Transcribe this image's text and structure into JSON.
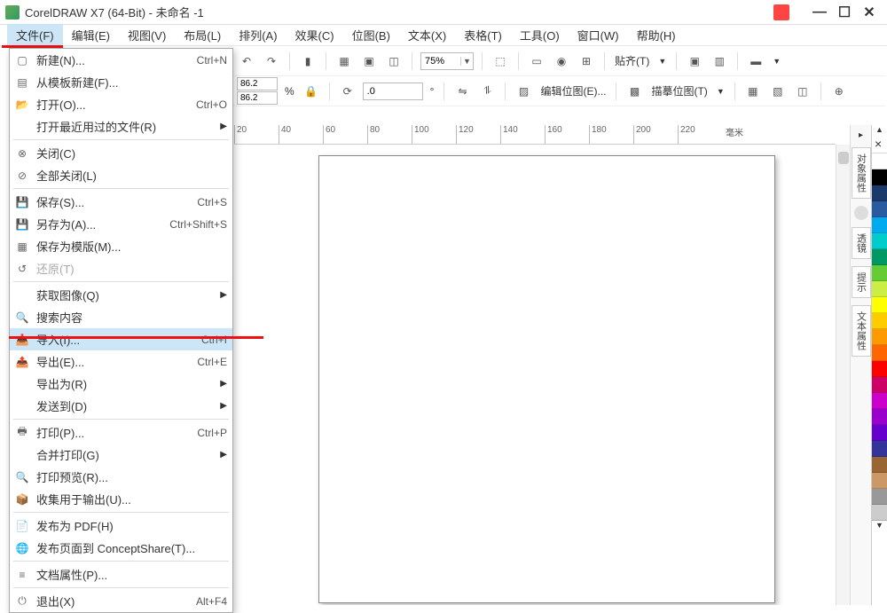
{
  "title": "CorelDRAW X7 (64-Bit) - 未命名 -1",
  "menus": [
    "文件(F)",
    "编辑(E)",
    "视图(V)",
    "布局(L)",
    "排列(A)",
    "效果(C)",
    "位图(B)",
    "文本(X)",
    "表格(T)",
    "工具(O)",
    "窗口(W)",
    "帮助(H)"
  ],
  "zoom": "75%",
  "snap_label": "贴齐(T)",
  "prop": {
    "x": "86.2",
    "y": "86.2",
    "pct": "%",
    "rot": ".0",
    "edit_bitmap": "编辑位图(E)...",
    "trace_bitmap": "描摹位图(T)"
  },
  "ruler": {
    "ticks": [
      "20",
      "40",
      "60",
      "80",
      "100",
      "120",
      "140",
      "160",
      "180",
      "200",
      "220"
    ],
    "unit": "毫米"
  },
  "file_menu": [
    {
      "icon": "new",
      "label": "新建(N)...",
      "shortcut": "Ctrl+N"
    },
    {
      "icon": "tpl",
      "label": "从模板新建(F)...",
      "shortcut": ""
    },
    {
      "icon": "open",
      "label": "打开(O)...",
      "shortcut": "Ctrl+O"
    },
    {
      "icon": "",
      "label": "打开最近用过的文件(R)",
      "shortcut": "",
      "arrow": true
    },
    {
      "sep": true
    },
    {
      "icon": "close",
      "label": "关闭(C)",
      "shortcut": ""
    },
    {
      "icon": "closeall",
      "label": "全部关闭(L)",
      "shortcut": ""
    },
    {
      "sep": true
    },
    {
      "icon": "save",
      "label": "保存(S)...",
      "shortcut": "Ctrl+S"
    },
    {
      "icon": "saveas",
      "label": "另存为(A)...",
      "shortcut": "Ctrl+Shift+S"
    },
    {
      "icon": "savetpl",
      "label": "保存为模版(M)...",
      "shortcut": ""
    },
    {
      "icon": "revert",
      "label": "还原(T)",
      "shortcut": "",
      "disabled": true
    },
    {
      "sep": true
    },
    {
      "icon": "",
      "label": "获取图像(Q)",
      "shortcut": "",
      "arrow": true
    },
    {
      "icon": "search",
      "label": "搜索内容",
      "shortcut": ""
    },
    {
      "icon": "import",
      "label": "导入(I)...",
      "shortcut": "Ctrl+I",
      "highlight": true
    },
    {
      "icon": "export",
      "label": "导出(E)...",
      "shortcut": "Ctrl+E"
    },
    {
      "icon": "",
      "label": "导出为(R)",
      "shortcut": "",
      "arrow": true
    },
    {
      "icon": "",
      "label": "发送到(D)",
      "shortcut": "",
      "arrow": true
    },
    {
      "sep": true
    },
    {
      "icon": "print",
      "label": "打印(P)...",
      "shortcut": "Ctrl+P"
    },
    {
      "icon": "",
      "label": "合并打印(G)",
      "shortcut": "",
      "arrow": true
    },
    {
      "icon": "preview",
      "label": "打印预览(R)...",
      "shortcut": ""
    },
    {
      "icon": "collect",
      "label": "收集用于输出(U)...",
      "shortcut": ""
    },
    {
      "sep": true
    },
    {
      "icon": "pdf",
      "label": "发布为 PDF(H)",
      "shortcut": ""
    },
    {
      "icon": "concept",
      "label": "发布页面到 ConceptShare(T)...",
      "shortcut": ""
    },
    {
      "sep": true
    },
    {
      "icon": "props",
      "label": "文档属性(P)...",
      "shortcut": ""
    },
    {
      "sep": true
    },
    {
      "icon": "exit",
      "label": "退出(X)",
      "shortcut": "Alt+F4"
    }
  ],
  "dockers": [
    "对象属性",
    "透镜",
    "提示",
    "文本属性"
  ],
  "palette": [
    "#ffffff",
    "#000000",
    "#1a3a6b",
    "#2a5aa0",
    "#00aaee",
    "#00cccc",
    "#009966",
    "#66cc33",
    "#ccee44",
    "#ffff00",
    "#ffcc00",
    "#ff9900",
    "#ff6600",
    "#ff0000",
    "#cc0066",
    "#cc00cc",
    "#9900cc",
    "#6600cc",
    "#333399",
    "#996633",
    "#cc9966",
    "#999999",
    "#cccccc"
  ]
}
